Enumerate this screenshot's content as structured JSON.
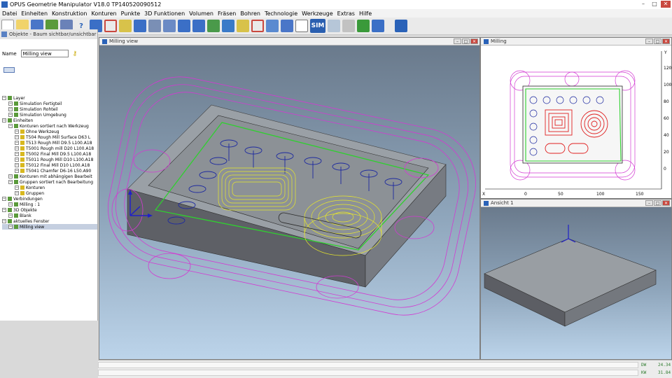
{
  "titlebar": {
    "title": "OPUS Geometrie Manipulator V18.0   TP140520090512"
  },
  "menu": [
    "Datei",
    "Einheiten",
    "Konstruktion",
    "Konturen",
    "Punkte",
    "3D Funktionen",
    "Volumen",
    "Fräsen",
    "Bohren",
    "Technologie",
    "Werkzeuge",
    "Extras",
    "Hilfe"
  ],
  "toolbar": {
    "sim_label": "SIM"
  },
  "left_panel": {
    "header": "Objekte - Baum sichtbar/unsichtbar",
    "name_label": "Name",
    "name_value": "Milling view",
    "tree": [
      {
        "indent": 0,
        "label": "Layer"
      },
      {
        "indent": 1,
        "label": "Simulation Fertigteil"
      },
      {
        "indent": 1,
        "label": "Simulation Rohteil"
      },
      {
        "indent": 1,
        "label": "Simulation Umgebung"
      },
      {
        "indent": 0,
        "label": "Einheiten"
      },
      {
        "indent": 1,
        "label": "Konturen sortiert nach Werkzeug"
      },
      {
        "indent": 2,
        "label": "Ohne Werkzeug"
      },
      {
        "indent": 2,
        "label": "T504 Rough Mill Surface D63 L"
      },
      {
        "indent": 2,
        "label": "T513 Rough Mill D9.5 L100.A18"
      },
      {
        "indent": 2,
        "label": "T5001 Rough mill D20 L100.A18"
      },
      {
        "indent": 2,
        "label": "T5002 Final Mill D9.5 L100.A18"
      },
      {
        "indent": 2,
        "label": "T5011 Rough Mill D10 L100.A18"
      },
      {
        "indent": 2,
        "label": "T5012 Final Mill D10 L100.A18"
      },
      {
        "indent": 2,
        "label": "T5041 Chamfer D6-16 L50.A90"
      },
      {
        "indent": 1,
        "label": "Konturen mit abhängigen Bearbeit"
      },
      {
        "indent": 1,
        "label": "Gruppen sortiert nach Bearbeitung"
      },
      {
        "indent": 2,
        "label": "Konturen"
      },
      {
        "indent": 2,
        "label": "Gruppen"
      },
      {
        "indent": 0,
        "label": "Verbindungen"
      },
      {
        "indent": 1,
        "label": "Milling : 1"
      },
      {
        "indent": 0,
        "label": "3D Objekte"
      },
      {
        "indent": 1,
        "label": "Blank"
      },
      {
        "indent": 0,
        "label": "aktuelles Fenster"
      },
      {
        "indent": 1,
        "label": "Milling view",
        "selected": true
      }
    ]
  },
  "panels": {
    "main": {
      "title": "Milling view"
    },
    "top_right": {
      "title": "Milling",
      "x_ticks": [
        "0",
        "50",
        "100",
        "150"
      ],
      "y_ticks": [
        "120",
        "100",
        "80",
        "60",
        "40",
        "20",
        "0"
      ],
      "x_axis": "X",
      "y_axis": "Y"
    },
    "bottom_right": {
      "title": "Ansicht 1"
    }
  },
  "status": {
    "dw_label": "DW",
    "dw_value": "24.34",
    "kw_label": "KW",
    "kw_value": "31.84"
  }
}
